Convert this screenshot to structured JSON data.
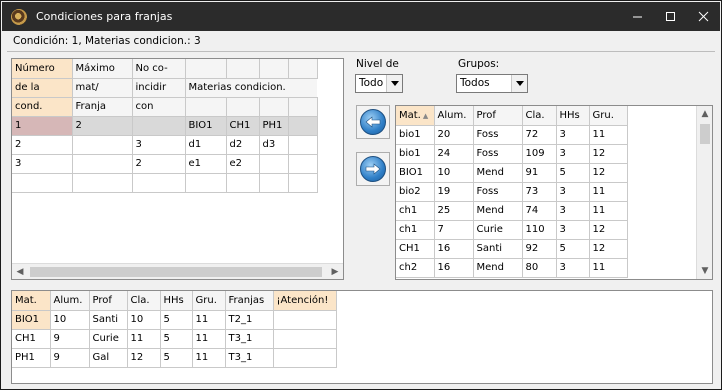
{
  "window": {
    "title": "Condiciones para franjas"
  },
  "status": {
    "text": "Condición: 1,   Materias condicion.: 3"
  },
  "conditions_grid": {
    "header_rows": [
      [
        "Número",
        "Máximo",
        "No co-",
        "",
        "",
        ""
      ],
      [
        "de la",
        "mat/",
        "incidir",
        "Materias condicion.",
        "",
        ""
      ],
      [
        "cond.",
        "Franja",
        "con",
        "",
        "",
        ""
      ]
    ],
    "rows": [
      [
        "1",
        "2",
        "",
        "BIO1",
        "CH1",
        "PH1"
      ],
      [
        "2",
        "",
        "3",
        "d1",
        "d2",
        "d3"
      ],
      [
        "3",
        "",
        "2",
        "e1",
        "e2",
        ""
      ],
      [
        "",
        "",
        "",
        "",
        "",
        ""
      ]
    ]
  },
  "filters": {
    "nivel_label": "Nivel de",
    "nivel_value": "Todo",
    "grupos_label": "Grupos:",
    "grupos_value": "Todos"
  },
  "buttons": {
    "left_icon": "arrow-left-icon",
    "right_icon": "arrow-right-icon"
  },
  "subjects_grid": {
    "columns": [
      "Mat.",
      "Alum.",
      "Prof",
      "Cla.",
      "HHs",
      "Gru."
    ],
    "rows": [
      [
        "bio1",
        "20",
        "Foss",
        "72",
        "3",
        "11"
      ],
      [
        "bio1",
        "24",
        "Foss",
        "109",
        "3",
        "12"
      ],
      [
        "BIO1",
        "10",
        "Mend",
        "91",
        "5",
        "12"
      ],
      [
        "bio2",
        "19",
        "Foss",
        "73",
        "3",
        "11"
      ],
      [
        "ch1",
        "25",
        "Mend",
        "74",
        "3",
        "11"
      ],
      [
        "ch1",
        "7",
        "Curie",
        "110",
        "3",
        "12"
      ],
      [
        "CH1",
        "16",
        "Santi",
        "92",
        "5",
        "12"
      ],
      [
        "ch2",
        "16",
        "Mend",
        "80",
        "3",
        "11"
      ]
    ]
  },
  "selected_grid": {
    "columns": [
      "Mat.",
      "Alum.",
      "Prof",
      "Cla.",
      "HHs",
      "Gru.",
      "Franjas",
      "¡Atención!"
    ],
    "rows": [
      [
        "BIO1",
        "10",
        "Santi",
        "10",
        "5",
        "11",
        "T2_1",
        ""
      ],
      [
        "CH1",
        "9",
        "Curie",
        "11",
        "5",
        "11",
        "T3_1",
        ""
      ],
      [
        "PH1",
        "9",
        "Gal",
        "12",
        "5",
        "11",
        "T3_1",
        ""
      ]
    ]
  },
  "colors": {
    "header_bg": "#fbe5c8",
    "titlebar_bg": "#2b2b2b",
    "selected_row": "#d9d9d9",
    "cursor_cell": "#d6b7b7"
  }
}
